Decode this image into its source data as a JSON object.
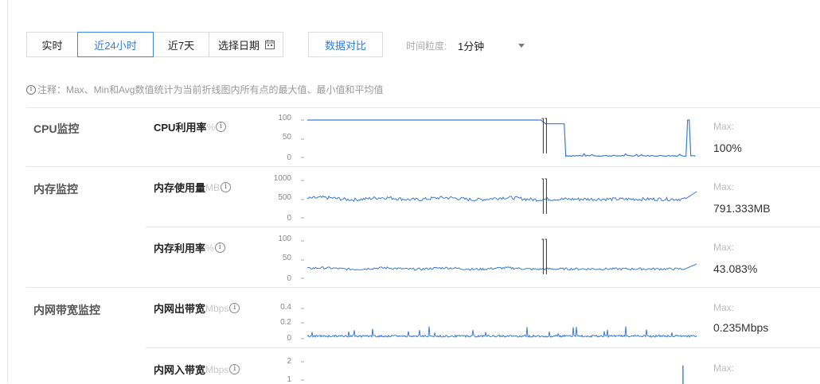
{
  "toolbar": {
    "time_buttons": [
      "实时",
      "近24小时",
      "近7天"
    ],
    "active_time": "近24小时",
    "date_picker": "选择日期",
    "compare": "数据对比",
    "granularity_label": "时间粒度:",
    "granularity_value": "1分钟"
  },
  "note": "注释：Max、Min和Avg数值统计为当前折线图内所有点的最大值、最小值和平均值",
  "groups": [
    {
      "title": "CPU监控"
    },
    {
      "title": "内存监控"
    },
    {
      "title": "内网带宽监控"
    }
  ],
  "metrics": [
    {
      "name": "CPU利用率",
      "unit": "%",
      "max_label": "Max:",
      "max_value": "100%",
      "yticks": [
        "100",
        "50",
        "0"
      ]
    },
    {
      "name": "内存使用量",
      "unit": "MB",
      "max_label": "Max:",
      "max_value": "791.333MB",
      "yticks": [
        "1000",
        "500",
        "0"
      ]
    },
    {
      "name": "内存利用率",
      "unit": "%",
      "max_label": "Max:",
      "max_value": "43.083%",
      "yticks": [
        "100",
        "50",
        "0"
      ]
    },
    {
      "name": "内网出带宽",
      "unit": "Mbps",
      "max_label": "Max:",
      "max_value": "0.235Mbps",
      "yticks": [
        "0.4",
        "0.2",
        "0"
      ]
    },
    {
      "name": "内网入带宽",
      "unit": "Mbps",
      "max_label": "Max:",
      "max_value": "",
      "yticks": [
        "2",
        "1"
      ]
    }
  ],
  "chart_data": [
    {
      "type": "line",
      "ylim": [
        0,
        100
      ],
      "break_at": 0.6,
      "segments": [
        {
          "from": 0,
          "to": 0.6,
          "level": 100
        },
        {
          "from": 0.6,
          "to": 0.66,
          "level": 90
        },
        {
          "from": 0.66,
          "to": 1.0,
          "level": 3,
          "spike_at": 0.978,
          "spike_value": 100
        }
      ]
    },
    {
      "type": "line",
      "ylim": [
        0,
        1000
      ],
      "break_at": 0.6,
      "base": 500,
      "noise": 90,
      "end_value": 700
    },
    {
      "type": "line",
      "ylim": [
        0,
        100
      ],
      "break_at": 0.6,
      "base": 25,
      "noise": 6,
      "end_value": 38
    },
    {
      "type": "line",
      "ylim": [
        0,
        0.4
      ],
      "base": 0.02,
      "noise": 0.05,
      "spike_value": 0.235
    },
    {
      "type": "line",
      "ylim": [
        0,
        2
      ],
      "spike_at": 0.965,
      "spike_value": 1.6
    }
  ],
  "colors": {
    "accent": "#2f7be6",
    "line": "#3a7bd5",
    "border": "#dcdcdc"
  },
  "icons": [
    "info-circle-icon",
    "calendar-icon",
    "caret-down-icon"
  ]
}
